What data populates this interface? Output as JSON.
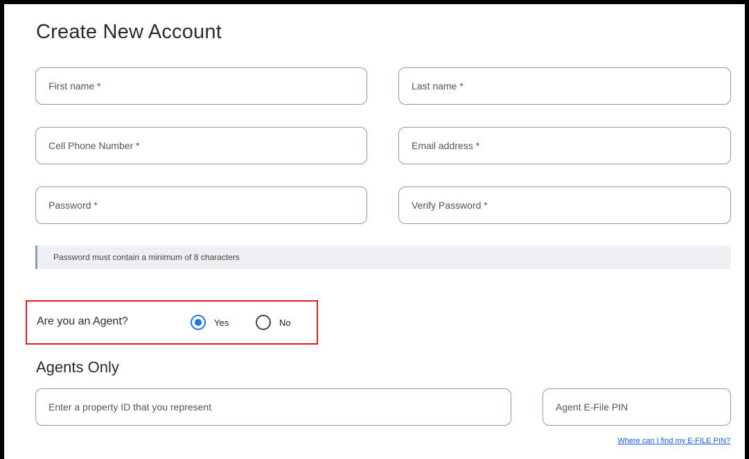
{
  "form": {
    "title": "Create New Account",
    "fields": {
      "first_name": {
        "placeholder": "First name *",
        "value": ""
      },
      "last_name": {
        "placeholder": "Last name *",
        "value": ""
      },
      "cell_phone": {
        "placeholder": "Cell Phone Number *",
        "value": ""
      },
      "email": {
        "placeholder": "Email address *",
        "value": ""
      },
      "password": {
        "placeholder": "Password *",
        "value": ""
      },
      "verify_password": {
        "placeholder": "Verify Password *",
        "value": ""
      }
    },
    "password_notice": "Password must contain a minimum of 8 characters"
  },
  "agent_question": {
    "label": "Are you an Agent?",
    "options": [
      {
        "label": "Yes",
        "selected": true
      },
      {
        "label": "No",
        "selected": false
      }
    ],
    "highlight_color": "#e01b1b"
  },
  "agents_only": {
    "title": "Agents Only",
    "property_id": {
      "placeholder": "Enter a property ID that you represent",
      "value": ""
    },
    "efile_pin": {
      "placeholder": "Agent E-File PIN",
      "value": ""
    },
    "help_link": "Where can I find my E-FILE PIN?"
  },
  "colors": {
    "accent": "#1a73e8",
    "field_border": "#8a9bb5",
    "notice_bg": "#eef0f2",
    "link": "#1a5fd6"
  }
}
